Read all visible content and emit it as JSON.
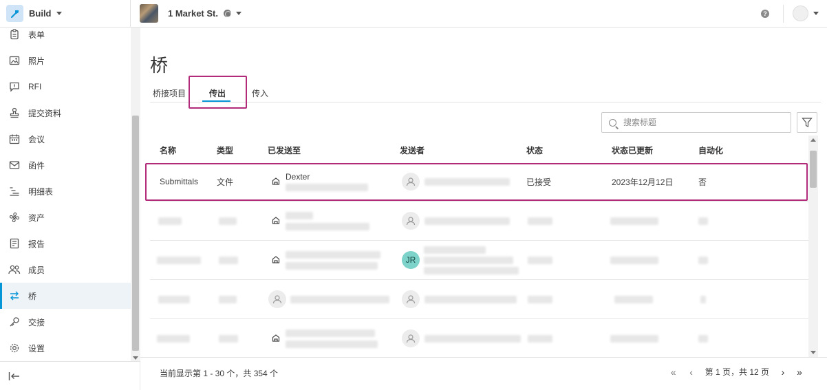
{
  "topbar": {
    "app_name": "Build",
    "project_name": "1 Market St.",
    "help_glyph": "?"
  },
  "sidebar": {
    "items": [
      {
        "label": "表单",
        "icon": "clipboard-icon"
      },
      {
        "label": "照片",
        "icon": "photo-icon"
      },
      {
        "label": "RFI",
        "icon": "rfi-chat-icon"
      },
      {
        "label": "提交资料",
        "icon": "stamp-icon"
      },
      {
        "label": "会议",
        "icon": "calendar-icon"
      },
      {
        "label": "函件",
        "icon": "mail-icon"
      },
      {
        "label": "明细表",
        "icon": "schedule-list-icon"
      },
      {
        "label": "资产",
        "icon": "fan-icon"
      },
      {
        "label": "报告",
        "icon": "report-icon"
      },
      {
        "label": "成员",
        "icon": "members-icon"
      },
      {
        "label": "桥",
        "icon": "bridge-arrows-icon",
        "active": true
      },
      {
        "label": "交接",
        "icon": "key-icon"
      },
      {
        "label": "设置",
        "icon": "gear-icon"
      }
    ],
    "collapse_glyph": "|←"
  },
  "main": {
    "title": "桥",
    "tabs": [
      {
        "label": "桥接项目"
      },
      {
        "label": "传出",
        "active": true
      },
      {
        "label": "传入"
      }
    ],
    "search": {
      "placeholder": "搜索标题"
    }
  },
  "table": {
    "columns": [
      "名称",
      "类型",
      "已发送至",
      "发送者",
      "状态",
      "状态已更新",
      "自动化"
    ],
    "first_row": {
      "name": "Submittals",
      "type": "文件",
      "sent_to": "Dexter",
      "status": "已接受",
      "status_updated": "2023年12月12日",
      "automation": "否"
    },
    "initials_badge": "JR"
  },
  "footer": {
    "count_text": "当前显示第 1 - 30 个，共 354 个",
    "page_text": "第 1 页，共 12 页"
  },
  "colors": {
    "accent": "#0696d7",
    "highlight": "#b12b7a",
    "initials_badge": "#7dd3c9"
  }
}
